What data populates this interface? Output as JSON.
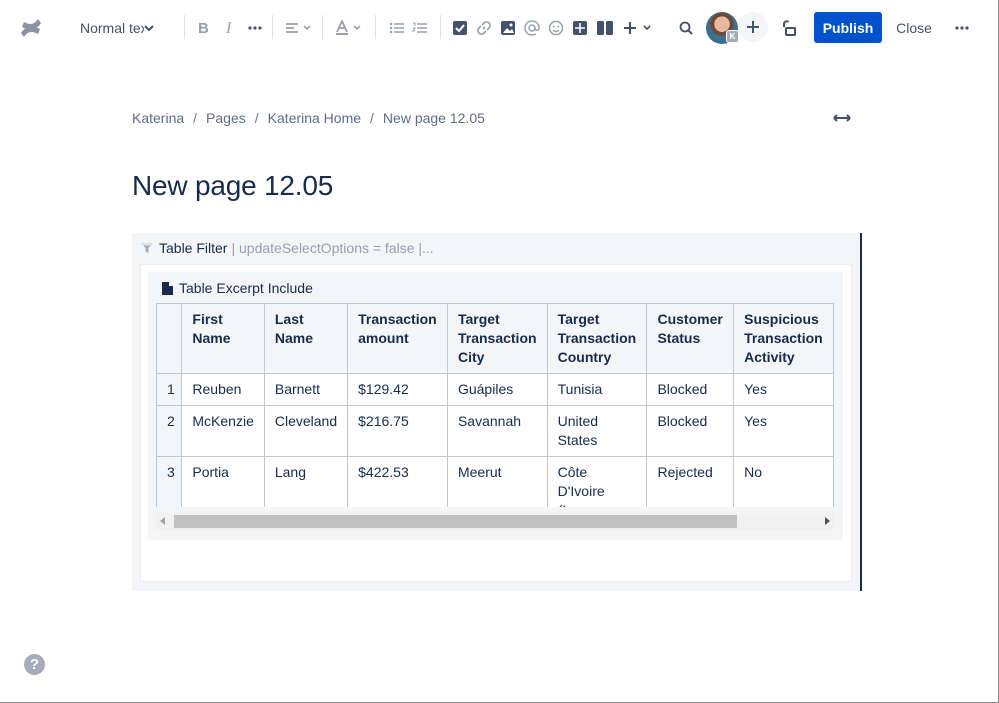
{
  "toolbar": {
    "text_style": "Normal text",
    "publish_label": "Publish",
    "close_label": "Close",
    "avatar_badge": "K",
    "icons": [
      "confluence-logo-icon",
      "bold-icon",
      "italic-icon",
      "more-formatting-icon",
      "align-icon",
      "text-color-icon",
      "bullet-list-icon",
      "numbered-list-icon",
      "task-icon",
      "link-icon",
      "image-icon",
      "mention-icon",
      "emoji-icon",
      "table-icon",
      "layouts-icon",
      "insert-icon",
      "search-icon",
      "invite-icon",
      "restrictions-icon",
      "more-icon"
    ]
  },
  "breadcrumb": {
    "items": [
      "Katerina",
      "Pages",
      "Katerina Home",
      "New page 12.05"
    ],
    "separator": "/"
  },
  "page": {
    "title": "New page 12.05"
  },
  "table_filter": {
    "label": "Table Filter",
    "params": "| updateSelectOptions = false |..."
  },
  "table_excerpt": {
    "label": "Table Excerpt Include",
    "headers": [
      "First Name",
      "Last Name",
      "Transaction amount",
      "Target Transaction City",
      "Target Transaction Country",
      "Customer Status",
      "Suspicious Transaction Activity"
    ],
    "rows": [
      {
        "n": "1",
        "cells": [
          "Reuben",
          "Barnett",
          "$129.42",
          "Guápiles",
          "Tunisia",
          "Blocked",
          "Yes"
        ]
      },
      {
        "n": "2",
        "cells": [
          "McKenzie",
          "Cleveland",
          "$216.75",
          "Savannah",
          "United States",
          "Blocked",
          "Yes"
        ]
      },
      {
        "n": "3",
        "cells": [
          "Portia",
          "Lang",
          "$422.53",
          "Meerut",
          "Côte D'Ivoire (Ivory Coast)",
          "Rejected",
          "No"
        ]
      }
    ]
  },
  "colors": {
    "primary": "#0052cc",
    "text": "#172b4d",
    "subtle": "#5e6c84",
    "panel": "#f4f5f7"
  }
}
